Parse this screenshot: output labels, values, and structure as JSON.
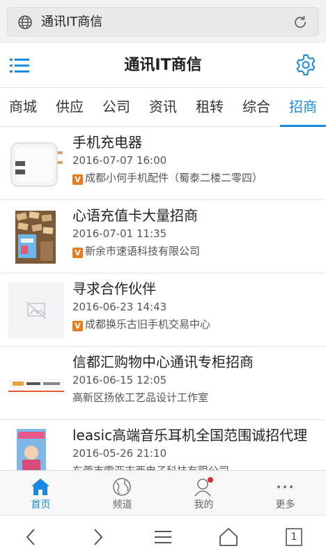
{
  "browser": {
    "url_text": "通讯IT商信",
    "icons": {
      "globe": "globe-icon",
      "reload": "reload-icon"
    }
  },
  "header": {
    "title": "通讯IT商信",
    "icons": {
      "menu": "menu-icon",
      "settings": "gear-icon"
    },
    "accent_color": "#1a8ae0"
  },
  "tabs": [
    {
      "label": "商城"
    },
    {
      "label": "供应"
    },
    {
      "label": "公司"
    },
    {
      "label": "资讯"
    },
    {
      "label": "租转"
    },
    {
      "label": "综合"
    },
    {
      "label": "招商",
      "active": true
    }
  ],
  "items": [
    {
      "title": "手机充电器",
      "date": "2016-07-07 16:00",
      "verified": true,
      "shop": "成都小何手机配件（蜀泰二楼二零四）",
      "thumb": "charger-image"
    },
    {
      "title": "心语充值卡大量招商",
      "date": "2016-07-01 11:35",
      "verified": true,
      "shop": "新余市速语科技有限公司",
      "thumb": "cards-image"
    },
    {
      "title": "寻求合作伙伴",
      "date": "2016-06-23 14:43",
      "verified": true,
      "shop": "成都换乐古旧手机交易中心",
      "thumb": "placeholder-image"
    },
    {
      "title": "信都汇购物中心通讯专柜招商",
      "date": "2016-06-15 12:05",
      "verified": false,
      "shop": "高新区扬依工艺品设计工作室",
      "thumb": "banner-image"
    },
    {
      "title": "leasic高端音乐耳机全国范围诚招代理",
      "date": "2016-05-26 21:10",
      "verified": false,
      "shop": "东莞市雷亚志西电子科技有限公司",
      "thumb": "poster-image"
    }
  ],
  "verified_badge": "V",
  "bottom_nav": [
    {
      "label": "首页",
      "icon": "home-icon",
      "active": true
    },
    {
      "label": "频道",
      "icon": "globe-icon"
    },
    {
      "label": "我的",
      "icon": "user-icon",
      "notify": true
    },
    {
      "label": "更多",
      "icon": "more-icon"
    }
  ],
  "browser_bar": {
    "tab_count": "1",
    "icons": [
      "back-icon",
      "forward-icon",
      "menu-icon",
      "home-icon",
      "tabs-icon"
    ]
  }
}
